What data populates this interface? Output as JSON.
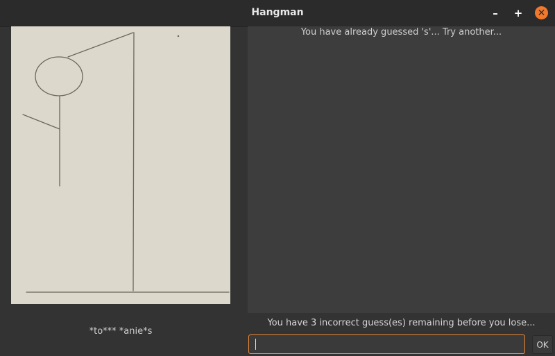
{
  "window": {
    "title": "Hangman",
    "minimize_glyph": "–",
    "maximize_glyph": "+",
    "close_glyph": "✕"
  },
  "game": {
    "masked_word": "*to*** *anie*s",
    "log_message": "You have already guessed 's'... Try another...",
    "status": "You have 3 incorrect guess(es) remaining before you lose...",
    "guess_value": "",
    "ok_label": "OK"
  },
  "colors": {
    "accent": "#f08b3a",
    "close_button": "#f2792b",
    "canvas_bg": "#dcd9cc",
    "ink": "#6b6658"
  }
}
